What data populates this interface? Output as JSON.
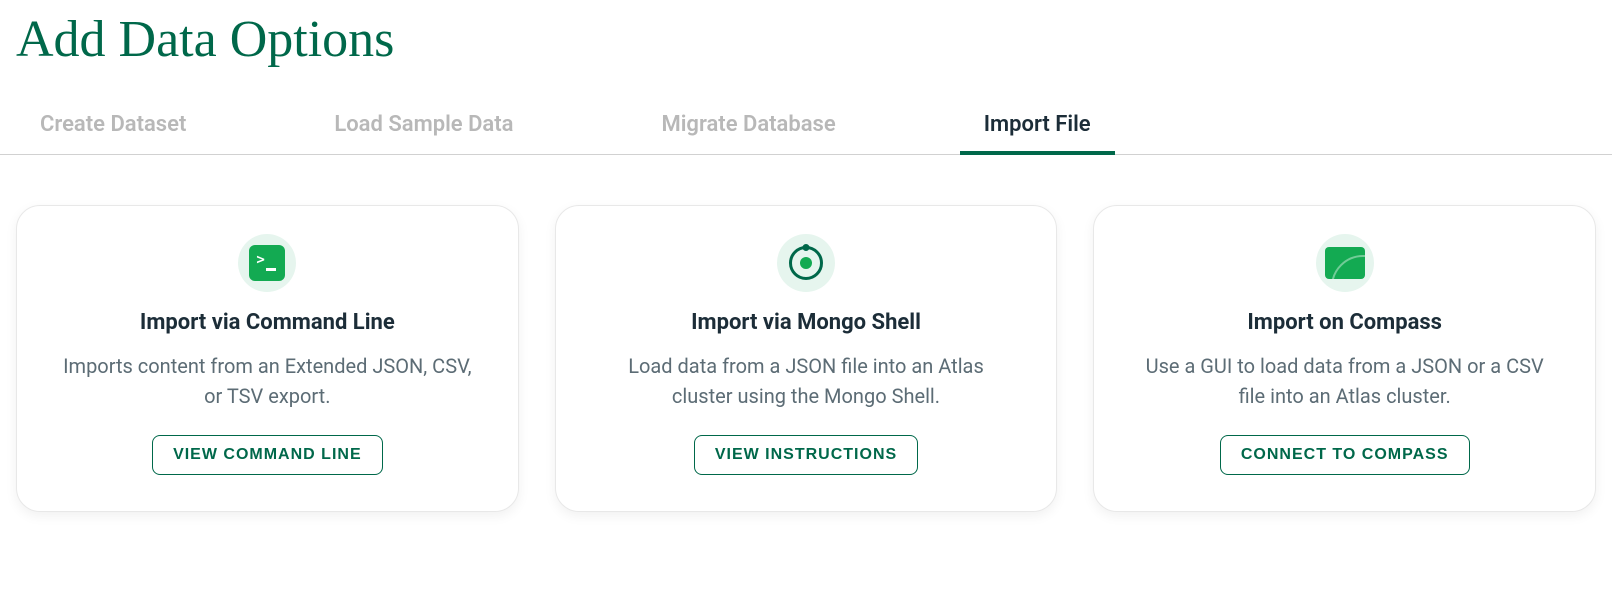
{
  "page": {
    "title": "Add Data Options"
  },
  "tabs": [
    {
      "label": "Create Dataset",
      "active": false
    },
    {
      "label": "Load Sample Data",
      "active": false
    },
    {
      "label": "Migrate Database",
      "active": false
    },
    {
      "label": "Import File",
      "active": true
    }
  ],
  "cards": [
    {
      "icon": "terminal-icon",
      "title": "Import via Command Line",
      "description": "Imports content from an Extended JSON, CSV, or TSV export.",
      "button": "VIEW COMMAND LINE"
    },
    {
      "icon": "mongo-shell-icon",
      "title": "Import via Mongo Shell",
      "description": "Load data from a JSON file into an Atlas cluster using the Mongo Shell.",
      "button": "VIEW INSTRUCTIONS"
    },
    {
      "icon": "compass-icon",
      "title": "Import on Compass",
      "description": "Use a GUI to load data from a JSON or a CSV file into an Atlas cluster.",
      "button": "CONNECT TO COMPASS"
    }
  ]
}
